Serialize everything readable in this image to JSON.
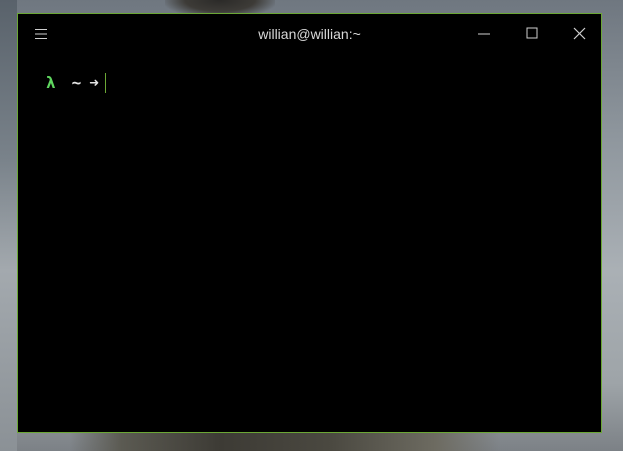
{
  "window": {
    "title": "willian@willian:~",
    "border_color": "#6ba735",
    "background": "#000000"
  },
  "titlebar": {
    "menu_icon": "hamburger-menu-icon",
    "minimize_icon": "minimize-icon",
    "maximize_icon": "maximize-icon",
    "close_icon": "close-icon"
  },
  "terminal": {
    "prompt": {
      "symbol": "λ",
      "directory": "~",
      "arrow": "➜",
      "symbol_color": "#5fd75f",
      "text_color": "#e4e4e4"
    },
    "input": ""
  }
}
